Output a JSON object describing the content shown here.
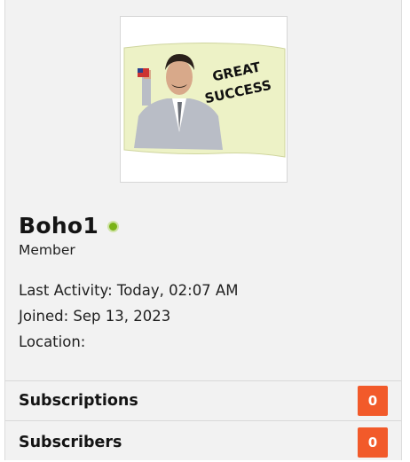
{
  "profile": {
    "username": "Boho1",
    "role": "Member",
    "online_status_color": "#7ab317",
    "avatar_text_line1": "GREAT",
    "avatar_text_line2": "SUCCESS"
  },
  "info": {
    "last_activity": "Last Activity: Today, 02:07 AM",
    "joined": "Joined: Sep 13, 2023",
    "location": "Location:"
  },
  "stats": [
    {
      "label": "Subscriptions",
      "count": "0"
    },
    {
      "label": "Subscribers",
      "count": "0"
    }
  ],
  "colors": {
    "badge": "#f25a2a",
    "card_bg": "#f2f2f2"
  }
}
